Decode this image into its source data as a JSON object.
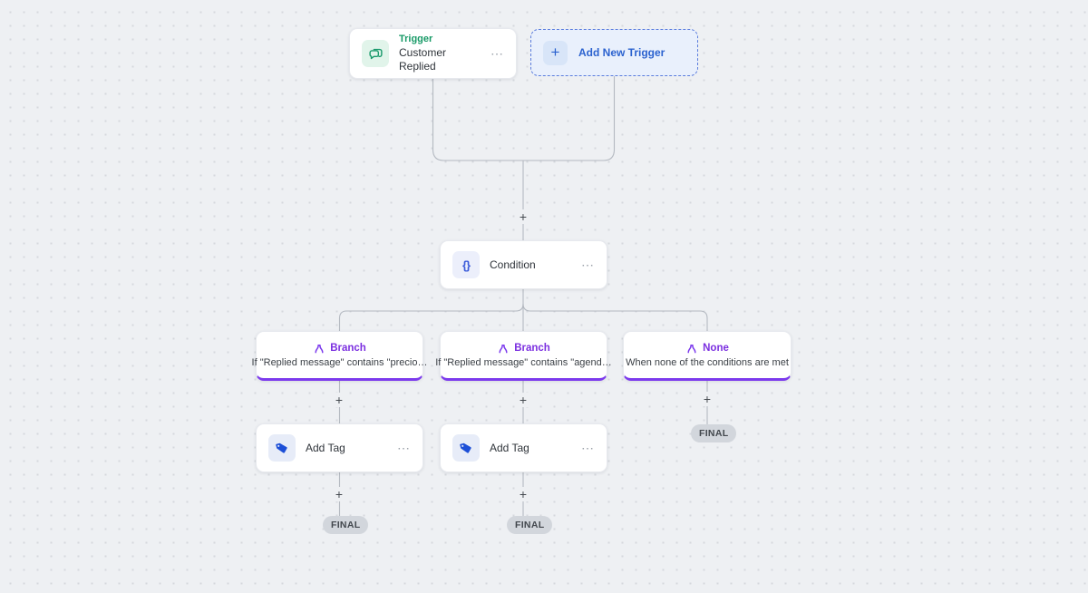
{
  "nodes": {
    "trigger": {
      "type_label": "Trigger",
      "title": "Customer Replied"
    },
    "add_new_trigger": {
      "label": "Add New Trigger",
      "plus_glyph": "+"
    },
    "condition": {
      "title": "Condition",
      "icon_glyph": "{}"
    },
    "branch1": {
      "type_label": "Branch",
      "condition_text": "If \"Replied message\" contains \"precio…"
    },
    "branch2": {
      "type_label": "Branch",
      "condition_text": "If \"Replied message\" contains \"agend…"
    },
    "branch_none": {
      "type_label": "None",
      "condition_text": "When none of the conditions are met"
    },
    "add_tag1": {
      "title": "Add Tag"
    },
    "add_tag2": {
      "title": "Add Tag"
    }
  },
  "ui": {
    "menu_glyph": "⋯",
    "plus_glyph": "+",
    "final_badge": "FINAL"
  },
  "colors": {
    "canvas_bg": "#eef0f3",
    "dot": "#d5d8dd",
    "wire": "#b4b9c1",
    "trigger_green": "#189a67",
    "action_blue": "#2b62cf",
    "condition_blue": "#3b5bd9",
    "branch_purple": "#7c3aed",
    "tag_blue": "#1d4fd7",
    "final_pill_bg": "#d2d6dc"
  }
}
